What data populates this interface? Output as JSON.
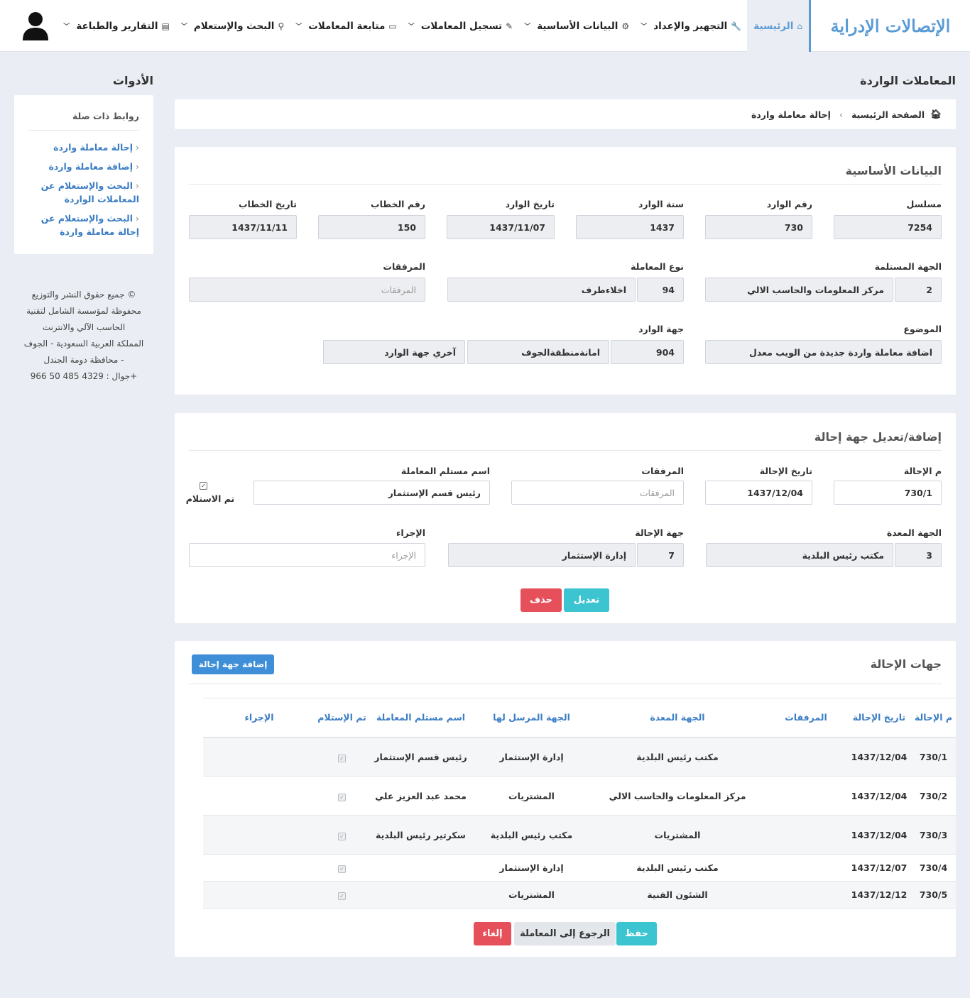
{
  "header": {
    "logo": "الإتصالات الإدراية",
    "nav": [
      {
        "label": "الرئيسية",
        "icon": "⌂",
        "active": true
      },
      {
        "label": "التجهيز والإعداد",
        "icon": "🔧"
      },
      {
        "label": "البيانات الأساسية",
        "icon": "⚙"
      },
      {
        "label": "تسجيل المعاملات",
        "icon": "✎"
      },
      {
        "label": "متابعة المعاملات",
        "icon": "▭"
      },
      {
        "label": "البحث والإستعلام",
        "icon": "⚲"
      },
      {
        "label": "التقارير والطباعة",
        "icon": "▤"
      }
    ]
  },
  "page_title": "المعاملات الواردة",
  "tools_title": "الأدوات",
  "sidebar": {
    "title": "روابط ذات صلة",
    "links": [
      "إحالة معاملة واردة",
      "إضافة معاملة واردة",
      "البحث والإستعلام عن المعاملات الواردة",
      "البحث والإستعلام عن إحالة معاملة واردة"
    ]
  },
  "copyright": [
    "© جميع حقوق النشر والتوزيع",
    "محفوظة لمؤسسة الشامل لتقنية",
    "الحاسب الآلي والانترنت",
    "المملكة العربية السعودية - الجوف",
    "- محافظة دومة الجندل",
    "جوال : 4329 485 50 966+"
  ],
  "breadcrumb": {
    "home": "الصفحة الرئيسية",
    "current": "إحالة معاملة واردة"
  },
  "basic": {
    "title": "البيانات الأساسية",
    "serial_label": "مسلسل",
    "serial": "7254",
    "incoming_no_label": "رقم الوارد",
    "incoming_no": "730",
    "incoming_year_label": "سنة الوارد",
    "incoming_year": "1437",
    "incoming_date_label": "تاريخ الوارد",
    "incoming_date": "1437/11/07",
    "letter_no_label": "رقم الخطاب",
    "letter_no": "150",
    "letter_date_label": "تاريخ الخطاب",
    "letter_date": "1437/11/11",
    "receiver_label": "الجهة المستلمة",
    "receiver_code": "2",
    "receiver_name": "مركز المعلومات والحاسب الالي",
    "type_label": "نوع المعاملة",
    "type_code": "94",
    "type_name": "اخلاءطرف",
    "attach_label": "المرفقات",
    "attach_placeholder": "المرفقات",
    "subject_label": "الموضوع",
    "subject": "اضافة معاملة واردة جديدة من الويب معدل",
    "source_label": "جهة الوارد",
    "source_code": "904",
    "source_name": "امانةمنطقةالجوف",
    "source_other": "آخري جهة الوارد"
  },
  "referral_form": {
    "title": "إضافة/تعديل جهة إحالة",
    "ref_no_label": "م الإحالة",
    "ref_no": "730/1",
    "ref_date_label": "تاريخ الإحالة",
    "ref_date": "1437/12/04",
    "attach_label": "المرفقات",
    "attach_placeholder": "المرفقات",
    "recipient_label": "اسم مستلم المعاملة",
    "recipient": "رئيس قسم الإستثمار",
    "received_label": "تم الاستلام",
    "prep_label": "الجهة المعدة",
    "prep_code": "3",
    "prep_name": "مكتب رئيس البلدية",
    "dest_label": "جهة الإحالة",
    "dest_code": "7",
    "dest_name": "إدارة الإستثمار",
    "action_label": "الإجراء",
    "action_placeholder": "الإجراء",
    "edit_btn": "تعديل",
    "delete_btn": "حذف"
  },
  "referrals": {
    "title": "جهات الإحالة",
    "add_btn": "إضافة جهة إحالة",
    "columns": [
      "م الإحالة",
      "تاريخ الإحالة",
      "المرفقات",
      "الجهة المعدة",
      "الجهة المرسل لها",
      "اسم مستلم المعاملة",
      "تم الإستلام",
      "الإجراء"
    ],
    "rows": [
      {
        "no": "730/1",
        "date": "1437/12/04",
        "attach": "",
        "prep": "مكتب رئيس البلدية",
        "to": "إدارة الإستثمار",
        "recipient": "رئيس قسم الإستثمار",
        "action": ""
      },
      {
        "no": "730/2",
        "date": "1437/12/04",
        "attach": "",
        "prep": "مركز المعلومات والحاسب الالي",
        "to": "المشتريات",
        "recipient": "محمد عبد العزيز علي",
        "action": ""
      },
      {
        "no": "730/3",
        "date": "1437/12/04",
        "attach": "",
        "prep": "المشتريات",
        "to": "مكتب رئيس البلدية",
        "recipient": "سكرتير رئيس البلدية",
        "action": ""
      },
      {
        "no": "730/4",
        "date": "1437/12/07",
        "attach": "",
        "prep": "مكتب رئيس البلدية",
        "to": "إدارة الإستثمار",
        "recipient": "",
        "action": ""
      },
      {
        "no": "730/5",
        "date": "1437/12/12",
        "attach": "",
        "prep": "الشئون الفنية",
        "to": "المشتريات",
        "recipient": "",
        "action": ""
      }
    ],
    "save_btn": "حفظ",
    "back_btn": "الرجوع إلى المعاملة",
    "cancel_btn": "إلغاء"
  }
}
